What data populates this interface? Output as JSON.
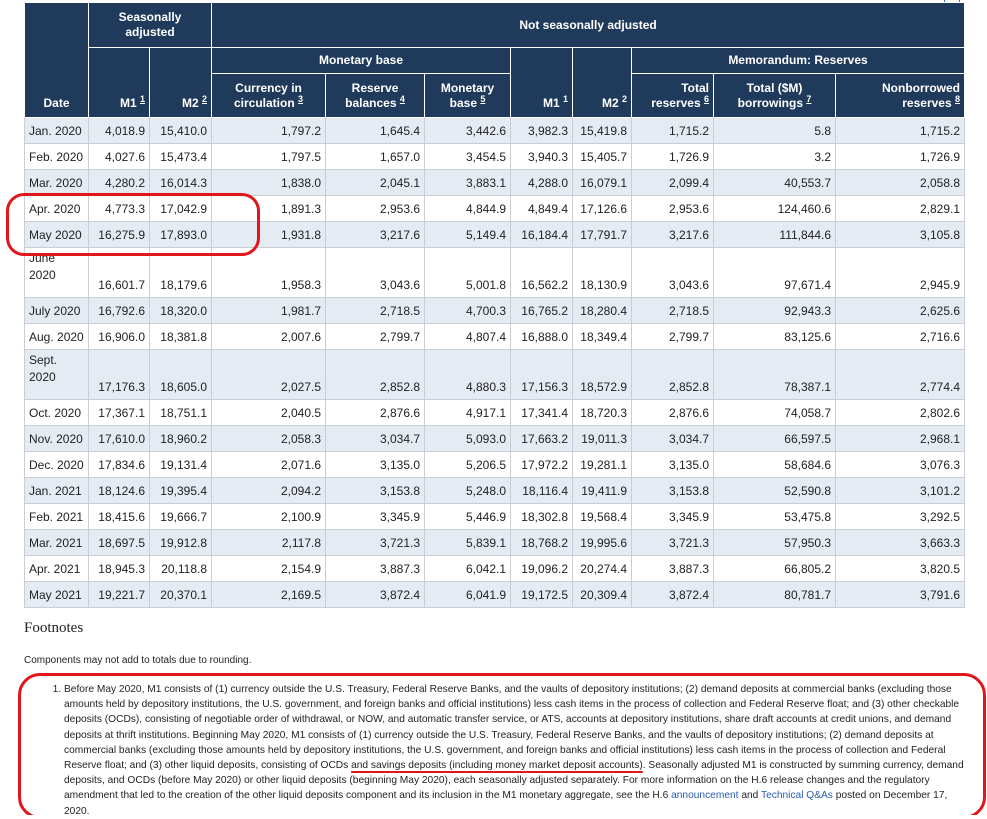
{
  "table": {
    "header": {
      "date": "Date",
      "seasonally_adjusted": "Seasonally adjusted",
      "not_seasonally_adjusted": "Not seasonally adjusted",
      "monetary_base": "Monetary base",
      "memorandum_reserves": "Memorandum: Reserves",
      "m1": "M1",
      "m2": "M2",
      "m1_fn": "1",
      "m2_fn": "2",
      "currency": "Currency in circulation",
      "currency_fn": "3",
      "reserve_balances": "Reserve balances",
      "reserve_balances_fn": "4",
      "monetary_base_col": "Monetary base",
      "monetary_base_fn": "5",
      "total_reserves": "Total reserves",
      "total_reserves_fn": "6",
      "total_borrowings": "Total ($M) borrowings",
      "total_borrowings_fn": "7",
      "nonborrowed": "Nonborrowed reserves",
      "nonborrowed_fn": "8"
    },
    "rows": [
      [
        "Jan. 2020",
        "4,018.9",
        "15,410.0",
        "1,797.2",
        "1,645.4",
        "3,442.6",
        "3,982.3",
        "15,419.8",
        "1,715.2",
        "5.8",
        "1,715.2"
      ],
      [
        "Feb. 2020",
        "4,027.6",
        "15,473.4",
        "1,797.5",
        "1,657.0",
        "3,454.5",
        "3,940.3",
        "15,405.7",
        "1,726.9",
        "3.2",
        "1,726.9"
      ],
      [
        "Mar. 2020",
        "4,280.2",
        "16,014.3",
        "1,838.0",
        "2,045.1",
        "3,883.1",
        "4,288.0",
        "16,079.1",
        "2,099.4",
        "40,553.7",
        "2,058.8"
      ],
      [
        "Apr. 2020",
        "4,773.3",
        "17,042.9",
        "1,891.3",
        "2,953.6",
        "4,844.9",
        "4,849.4",
        "17,126.6",
        "2,953.6",
        "124,460.6",
        "2,829.1"
      ],
      [
        "May 2020",
        "16,275.9",
        "17,893.0",
        "1,931.8",
        "3,217.6",
        "5,149.4",
        "16,184.4",
        "17,791.7",
        "3,217.6",
        "111,844.6",
        "3,105.8"
      ],
      [
        "June 2020",
        "16,601.7",
        "18,179.6",
        "1,958.3",
        "3,043.6",
        "5,001.8",
        "16,562.2",
        "18,130.9",
        "3,043.6",
        "97,671.4",
        "2,945.9"
      ],
      [
        "July 2020",
        "16,792.6",
        "18,320.0",
        "1,981.7",
        "2,718.5",
        "4,700.3",
        "16,765.2",
        "18,280.4",
        "2,718.5",
        "92,943.3",
        "2,625.6"
      ],
      [
        "Aug. 2020",
        "16,906.0",
        "18,381.8",
        "2,007.6",
        "2,799.7",
        "4,807.4",
        "16,888.0",
        "18,349.4",
        "2,799.7",
        "83,125.6",
        "2,716.6"
      ],
      [
        "Sept. 2020",
        "17,176.3",
        "18,605.0",
        "2,027.5",
        "2,852.8",
        "4,880.3",
        "17,156.3",
        "18,572.9",
        "2,852.8",
        "78,387.1",
        "2,774.4"
      ],
      [
        "Oct. 2020",
        "17,367.1",
        "18,751.1",
        "2,040.5",
        "2,876.6",
        "4,917.1",
        "17,341.4",
        "18,720.3",
        "2,876.6",
        "74,058.7",
        "2,802.6"
      ],
      [
        "Nov. 2020",
        "17,610.0",
        "18,960.2",
        "2,058.3",
        "3,034.7",
        "5,093.0",
        "17,663.2",
        "19,011.3",
        "3,034.7",
        "66,597.5",
        "2,968.1"
      ],
      [
        "Dec. 2020",
        "17,834.6",
        "19,131.4",
        "2,071.6",
        "3,135.0",
        "5,206.5",
        "17,972.2",
        "19,281.1",
        "3,135.0",
        "58,684.6",
        "3,076.3"
      ],
      [
        "Jan. 2021",
        "18,124.6",
        "19,395.4",
        "2,094.2",
        "3,153.8",
        "5,248.0",
        "18,116.4",
        "19,411.9",
        "3,153.8",
        "52,590.8",
        "3,101.2"
      ],
      [
        "Feb. 2021",
        "18,415.6",
        "19,666.7",
        "2,100.9",
        "3,345.9",
        "5,446.9",
        "18,302.8",
        "19,568.4",
        "3,345.9",
        "53,475.8",
        "3,292.5"
      ],
      [
        "Mar. 2021",
        "18,697.5",
        "19,912.8",
        "2,117.8",
        "3,721.3",
        "5,839.1",
        "18,768.2",
        "19,995.6",
        "3,721.3",
        "57,950.3",
        "3,663.3"
      ],
      [
        "Apr. 2021",
        "18,945.3",
        "20,118.8",
        "2,154.9",
        "3,887.3",
        "6,042.1",
        "19,096.2",
        "20,274.4",
        "3,887.3",
        "66,805.2",
        "3,820.5"
      ],
      [
        "May 2021",
        "19,221.7",
        "20,370.1",
        "2,169.5",
        "3,872.4",
        "6,041.9",
        "19,172.5",
        "20,309.4",
        "3,872.4",
        "80,781.7",
        "3,791.6"
      ]
    ]
  },
  "footnotes": {
    "title": "Footnotes",
    "components_note": "Components may not add to totals due to rounding.",
    "note1_part1": "Before May 2020, M1 consists of (1) currency outside the U.S. Treasury, Federal Reserve Banks, and the vaults of depository institutions; (2) demand deposits at commercial banks (excluding those amounts held by depository institutions, the U.S. government, and foreign banks and official institutions) less cash items in the process of collection and Federal Reserve float; and (3) other checkable deposits (OCDs), consisting of negotiable order of withdrawal, or NOW, and automatic transfer service, or ATS, accounts at depository institutions, share draft accounts at credit unions, and demand deposits at thrift institutions. Beginning May 2020, M1 consists of (1) currency outside the U.S. Treasury, Federal Reserve Banks, and the vaults of depository institutions; (2) demand deposits at commercial banks (excluding those amounts held by depository institutions, the U.S. government, and foreign banks and official institutions) less cash items in the process of collection and Federal Reserve float; and (3) other liquid deposits, consisting of OCDs ",
    "note1_underlined": "and savings deposits (including money market deposit accounts)",
    "note1_part2": ". Seasonally adjusted M1 is constructed by summing currency, demand deposits, and OCDs (before May 2020) or other liquid deposits (beginning May 2020), each seasonally adjusted separately. For more information on the H.6 release changes and the regulatory amendment that led to the creation of the other liquid deposits component and its inclusion in the M1 monetary aggregate, see the H.6 ",
    "link_announcement": "announcement",
    "and_text": " and ",
    "link_qa": "Technical Q&As",
    "note1_end": " posted on December 17, 2020."
  },
  "colors": {
    "header_bg": "#1f3a5a",
    "alt_row_bg": "#e4ebf3",
    "annotation_red": "#e0161b",
    "link_blue": "#2a5db0"
  }
}
